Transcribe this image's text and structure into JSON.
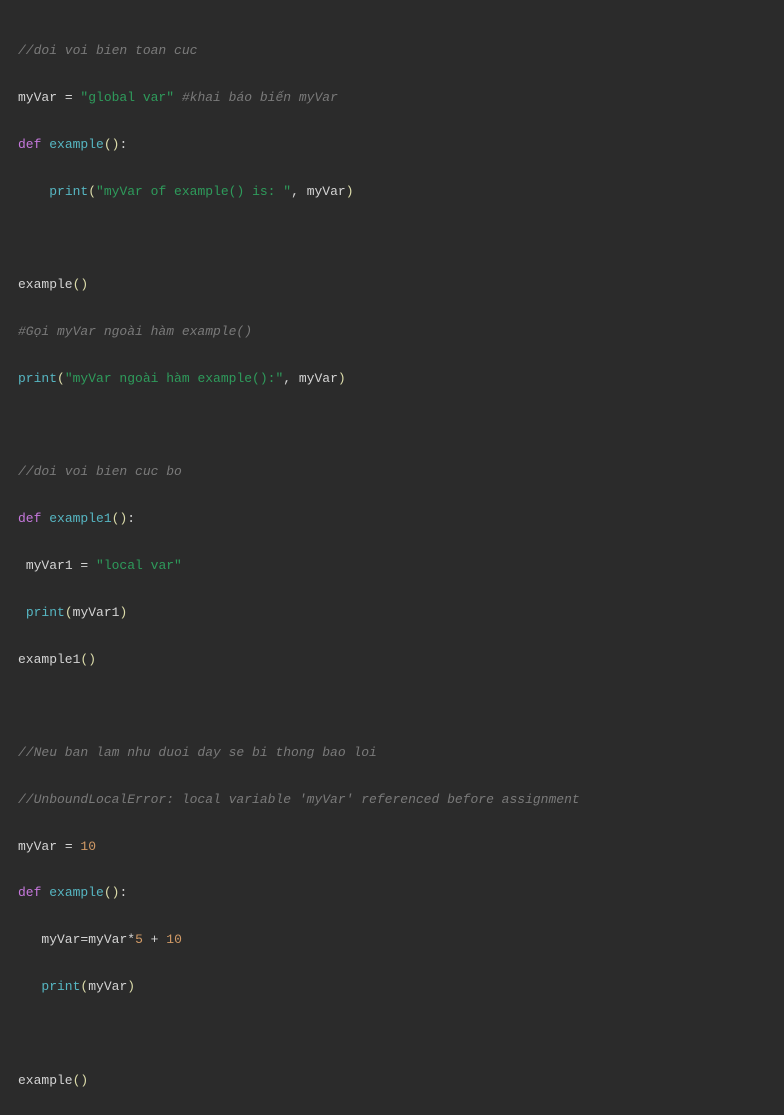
{
  "lines": {
    "l1_comment": "//doi voi bien toan cuc",
    "l2_var": "myVar",
    "l2_eq": " = ",
    "l2_str": "\"global var\"",
    "l2_comment": " #khai báo biến myVar",
    "l3_def": "def",
    "l3_space": " ",
    "l3_fn": "example",
    "l3_paren": "()",
    "l3_colon": ":",
    "l4_indent": "    ",
    "l4_print": "print",
    "l4_open": "(",
    "l4_str": "\"myVar of example() is: \"",
    "l4_comma": ", ",
    "l4_arg": "myVar",
    "l4_close": ")",
    "l6_call": "example",
    "l6_paren": "()",
    "l7_comment": "#Gọi myVar ngoài hàm example()",
    "l8_print": "print",
    "l8_open": "(",
    "l8_str": "\"myVar ngoài hàm example():\"",
    "l8_comma": ", ",
    "l8_arg": "myVar",
    "l8_close": ")",
    "l10_comment": "//doi voi bien cuc bo",
    "l11_def": "def",
    "l11_space": " ",
    "l11_fn": "example1",
    "l11_paren": "()",
    "l11_colon": ":",
    "l12_indent": " ",
    "l12_var": "myVar1",
    "l12_eq": " = ",
    "l12_str": "\"local var\"",
    "l13_indent": " ",
    "l13_print": "print",
    "l13_open": "(",
    "l13_arg": "myVar1",
    "l13_close": ")",
    "l14_call": "example1",
    "l14_paren": "()",
    "l16_comment": "//Neu ban lam nhu duoi day se bi thong bao loi",
    "l17_comment": "//UnboundLocalError: local variable 'myVar' referenced before assignment",
    "l18_var": "myVar",
    "l18_eq": " = ",
    "l18_num": "10",
    "l19_def": "def",
    "l19_space": " ",
    "l19_fn": "example",
    "l19_paren": "()",
    "l19_colon": ":",
    "l20_indent": "   ",
    "l20_var": "myVar",
    "l20_eq": "=",
    "l20_var2": "myVar",
    "l20_mul": "*",
    "l20_num5": "5",
    "l20_plus": " + ",
    "l20_num10": "10",
    "l21_indent": "   ",
    "l21_print": "print",
    "l21_open": "(",
    "l21_arg": "myVar",
    "l21_close": ")",
    "l23_call": "example",
    "l23_paren": "()"
  }
}
